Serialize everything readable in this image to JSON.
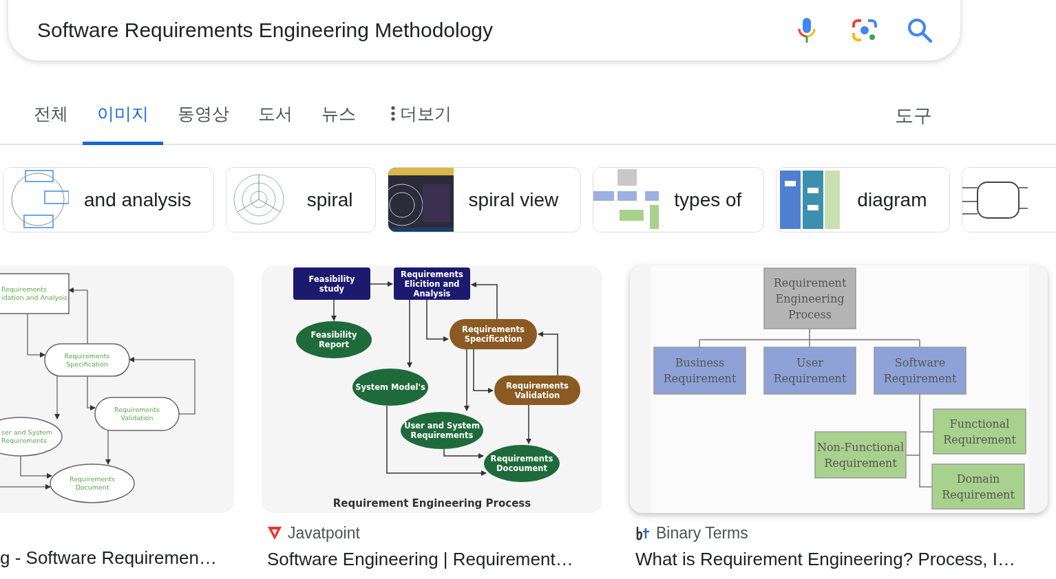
{
  "search": {
    "value": "Software Requirements Engineering Methodology"
  },
  "tabs": [
    {
      "label": "전체",
      "selected": false,
      "kind": "tab"
    },
    {
      "label": "이미지",
      "selected": true,
      "kind": "tab"
    },
    {
      "label": "동영상",
      "selected": false,
      "kind": "tab"
    },
    {
      "label": "도서",
      "selected": false,
      "kind": "tab"
    },
    {
      "label": "뉴스",
      "selected": false,
      "kind": "tab"
    },
    {
      "label": "더보기",
      "selected": false,
      "kind": "menu"
    }
  ],
  "tools": "도구",
  "chips": [
    {
      "label": "and analysis",
      "kind": "labelled"
    },
    {
      "label": "spiral",
      "kind": "labelled"
    },
    {
      "label": "spiral view",
      "kind": "labelled"
    },
    {
      "label": "types of",
      "kind": "labelled"
    },
    {
      "label": "diagram",
      "kind": "labelled"
    },
    {
      "kind": "picture"
    }
  ],
  "results": [
    {
      "title": "g - Software Requiremen…",
      "hovered": false,
      "diagram": {
        "nodes": [
          {
            "lines": [
              "Requirements",
              "idation and Analysis"
            ],
            "kind": "box"
          },
          {
            "lines": [
              "Requirements",
              "Specification"
            ],
            "kind": "pill"
          },
          {
            "lines": [
              "Requirements",
              "Validation"
            ],
            "kind": "pill"
          },
          {
            "lines": [
              "ser and System",
              "Requirements"
            ],
            "kind": "ellipse"
          },
          {
            "lines": [
              "Requirements",
              "Document"
            ],
            "kind": "ellipse"
          }
        ]
      }
    },
    {
      "source": "Javatpoint",
      "title": "Software Engineering | Requirement…",
      "hovered": false,
      "diagram": {
        "caption": "Requirement Engineering Process",
        "nodes": [
          {
            "lines": [
              "Feasibility",
              "study"
            ],
            "kind": "box",
            "color": "#1c1a6e"
          },
          {
            "lines": [
              "Requirements",
              "Elicition and",
              "Analysis"
            ],
            "kind": "box",
            "color": "#1c1a6e"
          },
          {
            "lines": [
              "Feasibility",
              "Report"
            ],
            "kind": "ellipse",
            "color": "#1f6a3a"
          },
          {
            "lines": [
              "Requirements",
              "Specification"
            ],
            "kind": "pill",
            "color": "#8a5a22"
          },
          {
            "lines": [
              "System Model's"
            ],
            "kind": "ellipse",
            "color": "#1f6a3a"
          },
          {
            "lines": [
              "Requirements",
              "Validation"
            ],
            "kind": "pill",
            "color": "#8a5a22"
          },
          {
            "lines": [
              "User and System",
              "Requirements"
            ],
            "kind": "ellipse",
            "color": "#1f6a3a"
          },
          {
            "lines": [
              "Requirements",
              "Docoument"
            ],
            "kind": "ellipse",
            "color": "#1f6a3a"
          }
        ]
      }
    },
    {
      "source": "Binary Terms",
      "title": "What is Requirement Engineering? Process, I…",
      "hovered": true,
      "diagram": {
        "nodes": [
          {
            "lines": [
              "Requirement",
              "Engineering",
              "Process"
            ],
            "kind": "box",
            "color": "#b4b4b4"
          },
          {
            "lines": [
              "Business",
              "Requirement"
            ],
            "kind": "box",
            "color": "#8ea2d8"
          },
          {
            "lines": [
              "User",
              "Requirement"
            ],
            "kind": "box",
            "color": "#8ea2d8"
          },
          {
            "lines": [
              "Software",
              "Requirement"
            ],
            "kind": "box",
            "color": "#8ea2d8"
          },
          {
            "lines": [
              "Functional",
              "Requirement"
            ],
            "kind": "box",
            "color": "#a9d18e"
          },
          {
            "lines": [
              "Non-Functional",
              "Requirement"
            ],
            "kind": "box",
            "color": "#a9d18e"
          },
          {
            "lines": [
              "Domain",
              "Requirement"
            ],
            "kind": "box",
            "color": "#a9d18e"
          }
        ]
      }
    }
  ]
}
